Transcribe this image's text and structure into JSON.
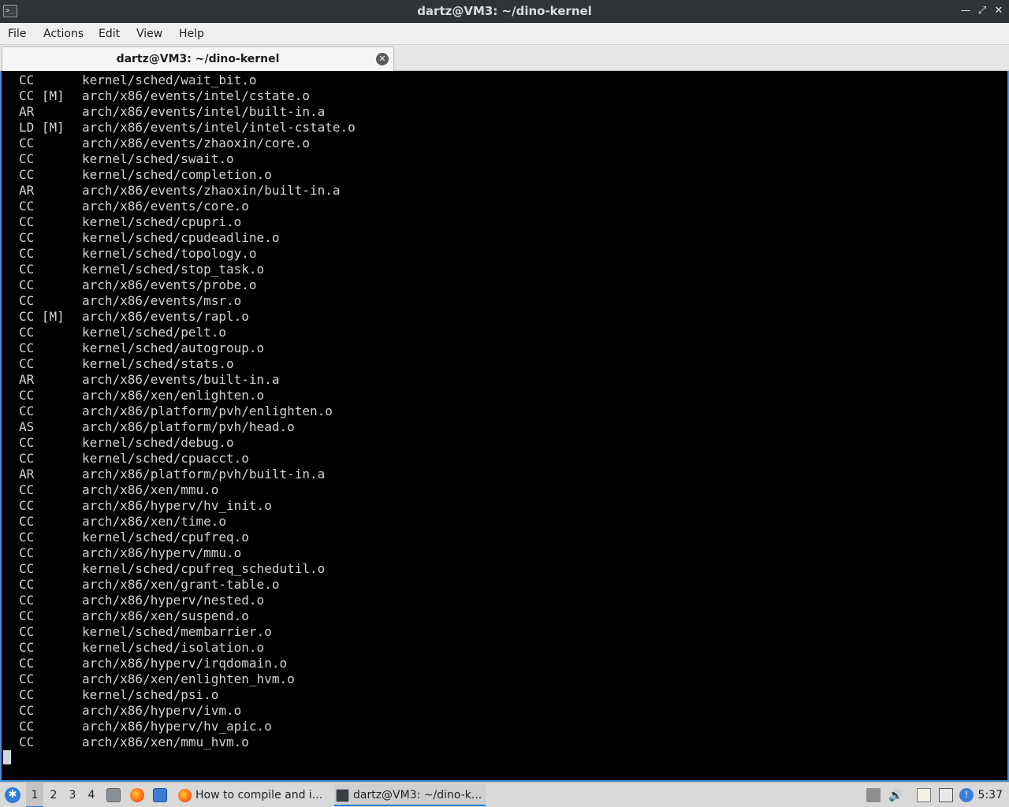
{
  "window": {
    "title": "dartz@VM3: ~/dino-kernel",
    "app_icon": "terminal-icon",
    "controls": [
      "minimize-icon",
      "restore-icon",
      "close-icon"
    ]
  },
  "menu": {
    "file": "File",
    "actions": "Actions",
    "edit": "Edit",
    "view": "View",
    "help": "Help"
  },
  "tab": {
    "label": "dartz@VM3: ~/dino-kernel",
    "close_icon": "close-circle-icon"
  },
  "terminal": {
    "lines": [
      {
        "cmd": "CC",
        "path": "kernel/sched/wait_bit.o"
      },
      {
        "cmd": "CC [M]",
        "path": "arch/x86/events/intel/cstate.o"
      },
      {
        "cmd": "AR",
        "path": "arch/x86/events/intel/built-in.a"
      },
      {
        "cmd": "LD [M]",
        "path": "arch/x86/events/intel/intel-cstate.o"
      },
      {
        "cmd": "CC",
        "path": "arch/x86/events/zhaoxin/core.o"
      },
      {
        "cmd": "CC",
        "path": "kernel/sched/swait.o"
      },
      {
        "cmd": "CC",
        "path": "kernel/sched/completion.o"
      },
      {
        "cmd": "AR",
        "path": "arch/x86/events/zhaoxin/built-in.a"
      },
      {
        "cmd": "CC",
        "path": "arch/x86/events/core.o"
      },
      {
        "cmd": "CC",
        "path": "kernel/sched/cpupri.o"
      },
      {
        "cmd": "CC",
        "path": "kernel/sched/cpudeadline.o"
      },
      {
        "cmd": "CC",
        "path": "kernel/sched/topology.o"
      },
      {
        "cmd": "CC",
        "path": "kernel/sched/stop_task.o"
      },
      {
        "cmd": "CC",
        "path": "arch/x86/events/probe.o"
      },
      {
        "cmd": "CC",
        "path": "arch/x86/events/msr.o"
      },
      {
        "cmd": "CC [M]",
        "path": "arch/x86/events/rapl.o"
      },
      {
        "cmd": "CC",
        "path": "kernel/sched/pelt.o"
      },
      {
        "cmd": "CC",
        "path": "kernel/sched/autogroup.o"
      },
      {
        "cmd": "CC",
        "path": "kernel/sched/stats.o"
      },
      {
        "cmd": "AR",
        "path": "arch/x86/events/built-in.a"
      },
      {
        "cmd": "CC",
        "path": "arch/x86/xen/enlighten.o"
      },
      {
        "cmd": "CC",
        "path": "arch/x86/platform/pvh/enlighten.o"
      },
      {
        "cmd": "AS",
        "path": "arch/x86/platform/pvh/head.o"
      },
      {
        "cmd": "CC",
        "path": "kernel/sched/debug.o"
      },
      {
        "cmd": "CC",
        "path": "kernel/sched/cpuacct.o"
      },
      {
        "cmd": "AR",
        "path": "arch/x86/platform/pvh/built-in.a"
      },
      {
        "cmd": "CC",
        "path": "arch/x86/xen/mmu.o"
      },
      {
        "cmd": "CC",
        "path": "arch/x86/hyperv/hv_init.o"
      },
      {
        "cmd": "CC",
        "path": "arch/x86/xen/time.o"
      },
      {
        "cmd": "CC",
        "path": "kernel/sched/cpufreq.o"
      },
      {
        "cmd": "CC",
        "path": "arch/x86/hyperv/mmu.o"
      },
      {
        "cmd": "CC",
        "path": "kernel/sched/cpufreq_schedutil.o"
      },
      {
        "cmd": "CC",
        "path": "arch/x86/xen/grant-table.o"
      },
      {
        "cmd": "CC",
        "path": "arch/x86/hyperv/nested.o"
      },
      {
        "cmd": "CC",
        "path": "arch/x86/xen/suspend.o"
      },
      {
        "cmd": "CC",
        "path": "kernel/sched/membarrier.o"
      },
      {
        "cmd": "CC",
        "path": "kernel/sched/isolation.o"
      },
      {
        "cmd": "CC",
        "path": "arch/x86/hyperv/irqdomain.o"
      },
      {
        "cmd": "CC",
        "path": "arch/x86/xen/enlighten_hvm.o"
      },
      {
        "cmd": "CC",
        "path": "kernel/sched/psi.o"
      },
      {
        "cmd": "CC",
        "path": "arch/x86/hyperv/ivm.o"
      },
      {
        "cmd": "CC",
        "path": "arch/x86/hyperv/hv_apic.o"
      },
      {
        "cmd": "CC",
        "path": "arch/x86/xen/mmu_hvm.o"
      }
    ]
  },
  "taskbar": {
    "start_icon": "lubuntu-start-icon",
    "desktops": [
      "1",
      "2",
      "3",
      "4"
    ],
    "active_desktop": "1",
    "launchers": [
      "file-manager-icon",
      "firefox-icon",
      "show-desktop-icon"
    ],
    "tasks": [
      {
        "label": "How to compile and i...",
        "icon": "firefox-icon",
        "active": false
      },
      {
        "label": "dartz@VM3: ~/dino-k...",
        "icon": "terminal-icon",
        "active": true
      }
    ],
    "tray": [
      "removable-media-icon",
      "volume-icon",
      "clipboard-icon",
      "network-icon",
      "update-notifier-icon"
    ],
    "clock": "5:37"
  },
  "colors": {
    "terminal_bg": "#000000",
    "terminal_fg": "#d3d3d3",
    "accent": "#4a90d9",
    "titlebar_bg": "#2f3438"
  }
}
